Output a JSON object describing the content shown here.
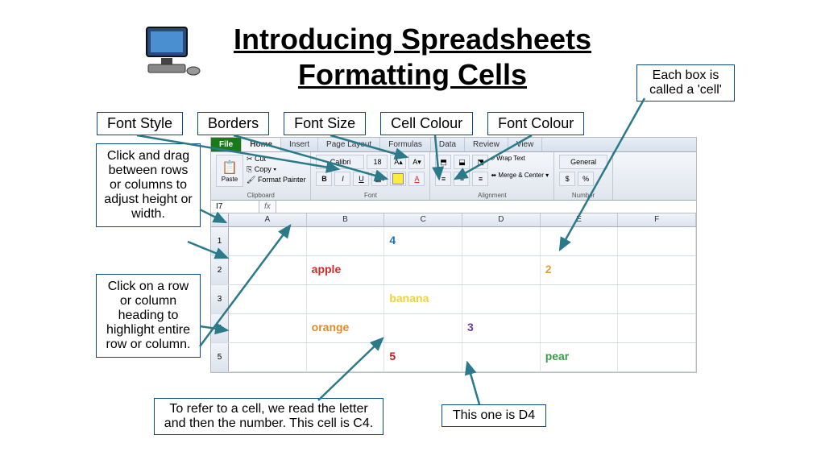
{
  "title": "Introducing Spreadsheets",
  "subtitle": "Formatting Cells",
  "labels": {
    "font_style": "Font Style",
    "borders": "Borders",
    "font_size": "Font Size",
    "cell_colour": "Cell Colour",
    "font_colour": "Font Colour"
  },
  "callouts": {
    "cell": "Each box is called a 'cell'",
    "drag": "Click and drag between rows or columns to adjust height or width.",
    "heading": "Click on a row or column heading to highlight entire row or column.",
    "refer": "To refer to a cell, we read the letter and then the number. This cell is C4.",
    "d4": "This one is D4"
  },
  "ribbon": {
    "tabs": [
      "File",
      "Home",
      "Insert",
      "Page Layout",
      "Formulas",
      "Data",
      "Review",
      "View"
    ],
    "clipboard": {
      "label": "Clipboard",
      "paste": "Paste",
      "cut": "Cut",
      "copy": "Copy ▾",
      "format_painter": "Format Painter"
    },
    "font": {
      "label": "Font",
      "name": "Calibri",
      "size": "18",
      "bold": "B",
      "italic": "I",
      "underline": "U"
    },
    "alignment": {
      "label": "Alignment",
      "wrap": "Wrap Text",
      "merge": "Merge & Center ▾"
    },
    "number": {
      "label": "Number",
      "format": "General"
    }
  },
  "formula_bar": {
    "name_box": "I7",
    "fx": "fx"
  },
  "columns": [
    "A",
    "B",
    "C",
    "D",
    "E",
    "F"
  ],
  "rows": [
    "1",
    "2",
    "3",
    "4",
    "5"
  ],
  "cells": {
    "c1": {
      "text": "4",
      "color": "#1f6fc0"
    },
    "b2": {
      "text": "apple",
      "color": "#d02a2a"
    },
    "e2": {
      "text": "2",
      "color": "#e8a030"
    },
    "c3": {
      "text": "banana",
      "color": "#f0d040"
    },
    "b4": {
      "text": "orange",
      "color": "#e08a2a"
    },
    "d4": {
      "text": "3",
      "color": "#6a3aa0"
    },
    "c5": {
      "text": "5",
      "color": "#c02020"
    },
    "e5": {
      "text": "pear",
      "color": "#3a9a4a"
    }
  }
}
